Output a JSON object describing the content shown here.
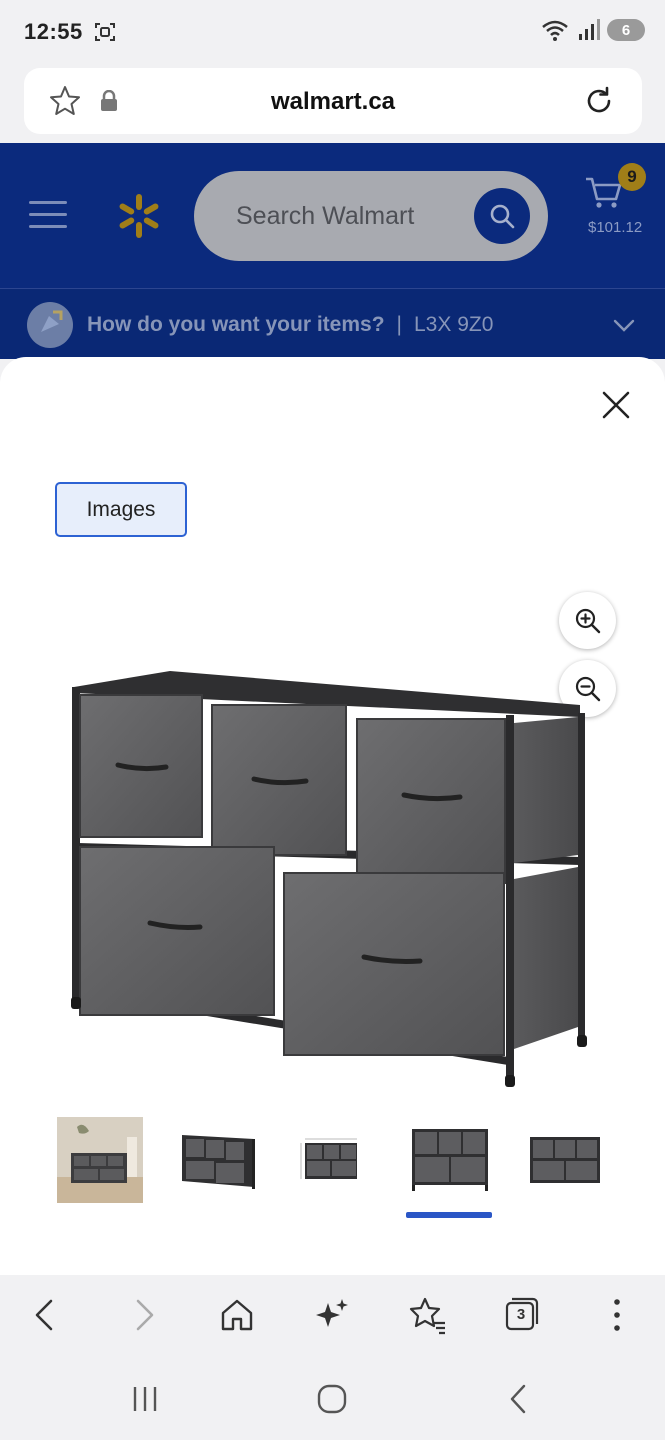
{
  "status_bar": {
    "time": "12:55",
    "battery_level": "6"
  },
  "browser": {
    "url": "walmart.ca"
  },
  "walmart_header": {
    "search_placeholder": "Search Walmart",
    "cart_count": "9",
    "cart_total": "$101.12",
    "delivery_prompt": "How do you want your items?",
    "delivery_separator": "|",
    "postal_code": "L3X 9Z0"
  },
  "modal": {
    "tab_label": "Images",
    "thumbnails": [
      {
        "name": "thumbnail-1",
        "selected": false
      },
      {
        "name": "thumbnail-2",
        "selected": false
      },
      {
        "name": "thumbnail-3",
        "selected": false
      },
      {
        "name": "thumbnail-4",
        "selected": true
      },
      {
        "name": "thumbnail-5",
        "selected": false
      }
    ]
  },
  "browser_nav": {
    "tabs_count": "3"
  },
  "icons": [
    "star-icon",
    "lock-icon",
    "reload-icon",
    "menu-icon",
    "walmart-spark-icon",
    "search-icon",
    "cart-icon",
    "location-icon",
    "chevron-down-icon",
    "close-icon",
    "zoom-in-icon",
    "zoom-out-icon",
    "back-icon",
    "forward-icon",
    "home-icon",
    "sparkle-icon",
    "bookmarks-icon",
    "tabs-icon",
    "more-icon",
    "recents-icon",
    "home-button-icon",
    "system-back-icon"
  ],
  "colors": {
    "walmart_blue": "#0b2a7d",
    "spark_yellow": "#a07e18",
    "active_indicator": "#2a56c6"
  }
}
